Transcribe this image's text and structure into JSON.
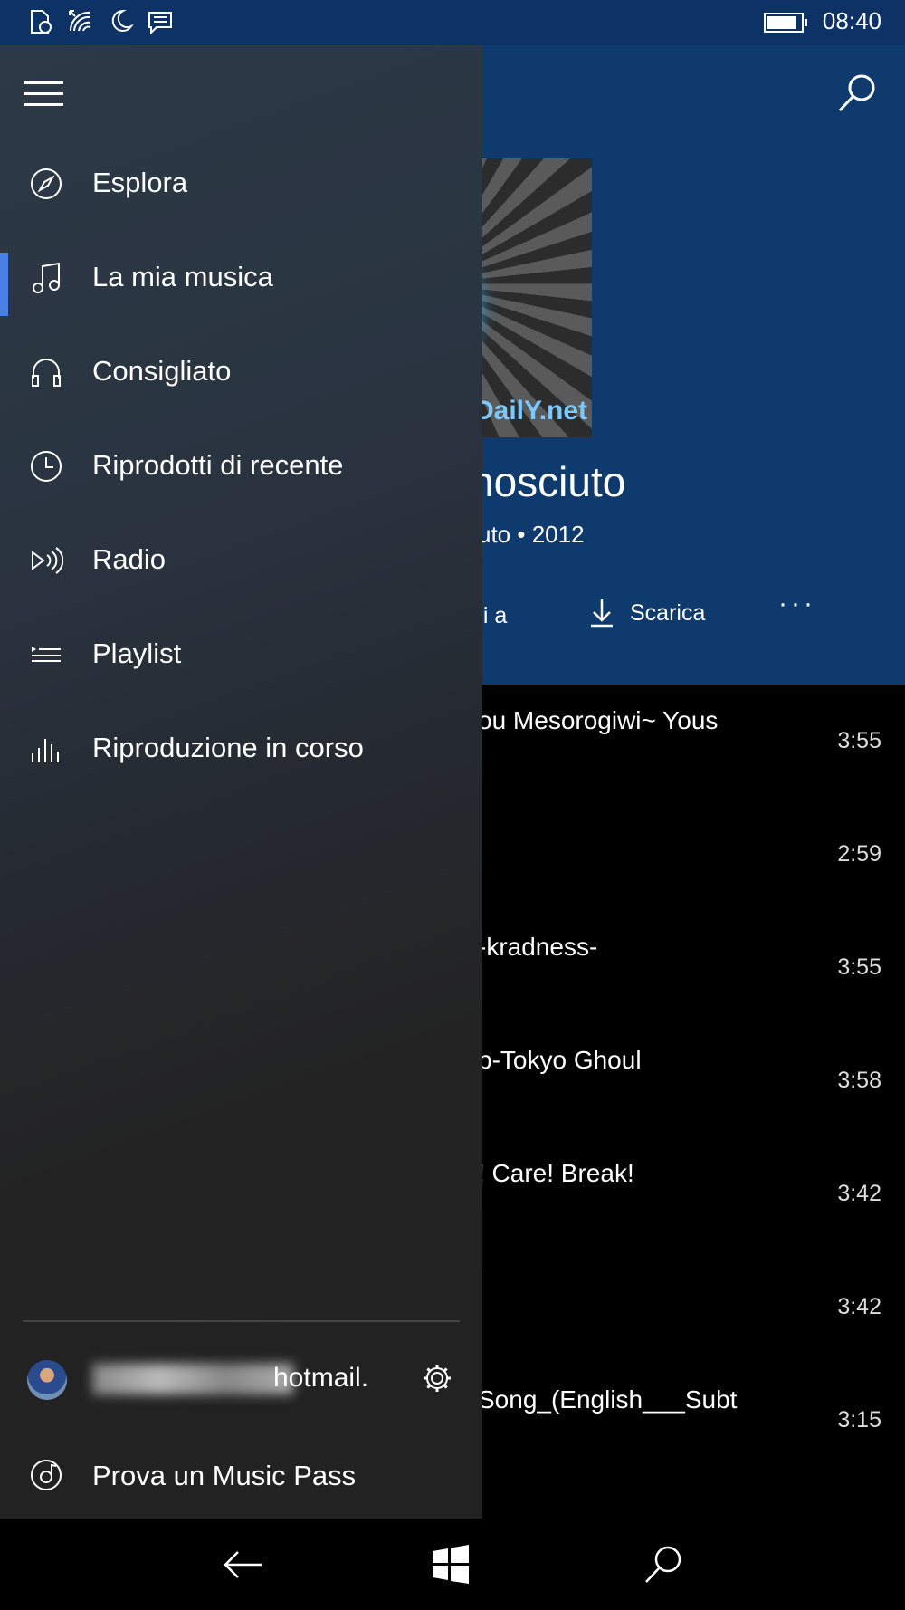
{
  "status_bar": {
    "time": "08:40",
    "icons": [
      "battery-saver-icon",
      "wifi-icon",
      "quiet-hours-icon",
      "message-icon"
    ],
    "battery_level": 0.9
  },
  "background_app": {
    "album_art_text": "DailY.net",
    "album_title": "nosciuto",
    "album_subtitle": "uto • 2012",
    "actions": {
      "add_label": "gi a",
      "download_label": "Scarica",
      "more_label": "···"
    },
    "tracks": [
      {
        "title": "ou Mesorogiwi~ Yous",
        "duration": "3:55"
      },
      {
        "title": "",
        "duration": "2:59"
      },
      {
        "title": "-kradness-",
        "duration": "3:55"
      },
      {
        "title": "p-Tokyo Ghoul",
        "duration": "3:58"
      },
      {
        "title": "! Care! Break!",
        "duration": "3:42"
      },
      {
        "title": "",
        "duration": "3:42"
      },
      {
        "title": "Song_(English___Subt",
        "duration": "3:15"
      }
    ]
  },
  "nav_pane": {
    "items": [
      {
        "label": "Esplora",
        "icon": "compass-icon",
        "selected": false
      },
      {
        "label": "La mia musica",
        "icon": "music-note-icon",
        "selected": true
      },
      {
        "label": "Consigliato",
        "icon": "headphones-icon",
        "selected": false
      },
      {
        "label": "Riprodotti di recente",
        "icon": "clock-icon",
        "selected": false
      },
      {
        "label": "Radio",
        "icon": "radio-icon",
        "selected": false
      },
      {
        "label": "Playlist",
        "icon": "playlist-icon",
        "selected": false
      },
      {
        "label": "Riproduzione in corso",
        "icon": "equalizer-icon",
        "selected": false
      }
    ],
    "account_email": "hotmail.",
    "music_pass_label": "Prova un Music Pass"
  },
  "colors": {
    "accent": "#4a7fe5",
    "header_bg": "#0f3a6d",
    "statusbar_bg": "#0d3366"
  }
}
